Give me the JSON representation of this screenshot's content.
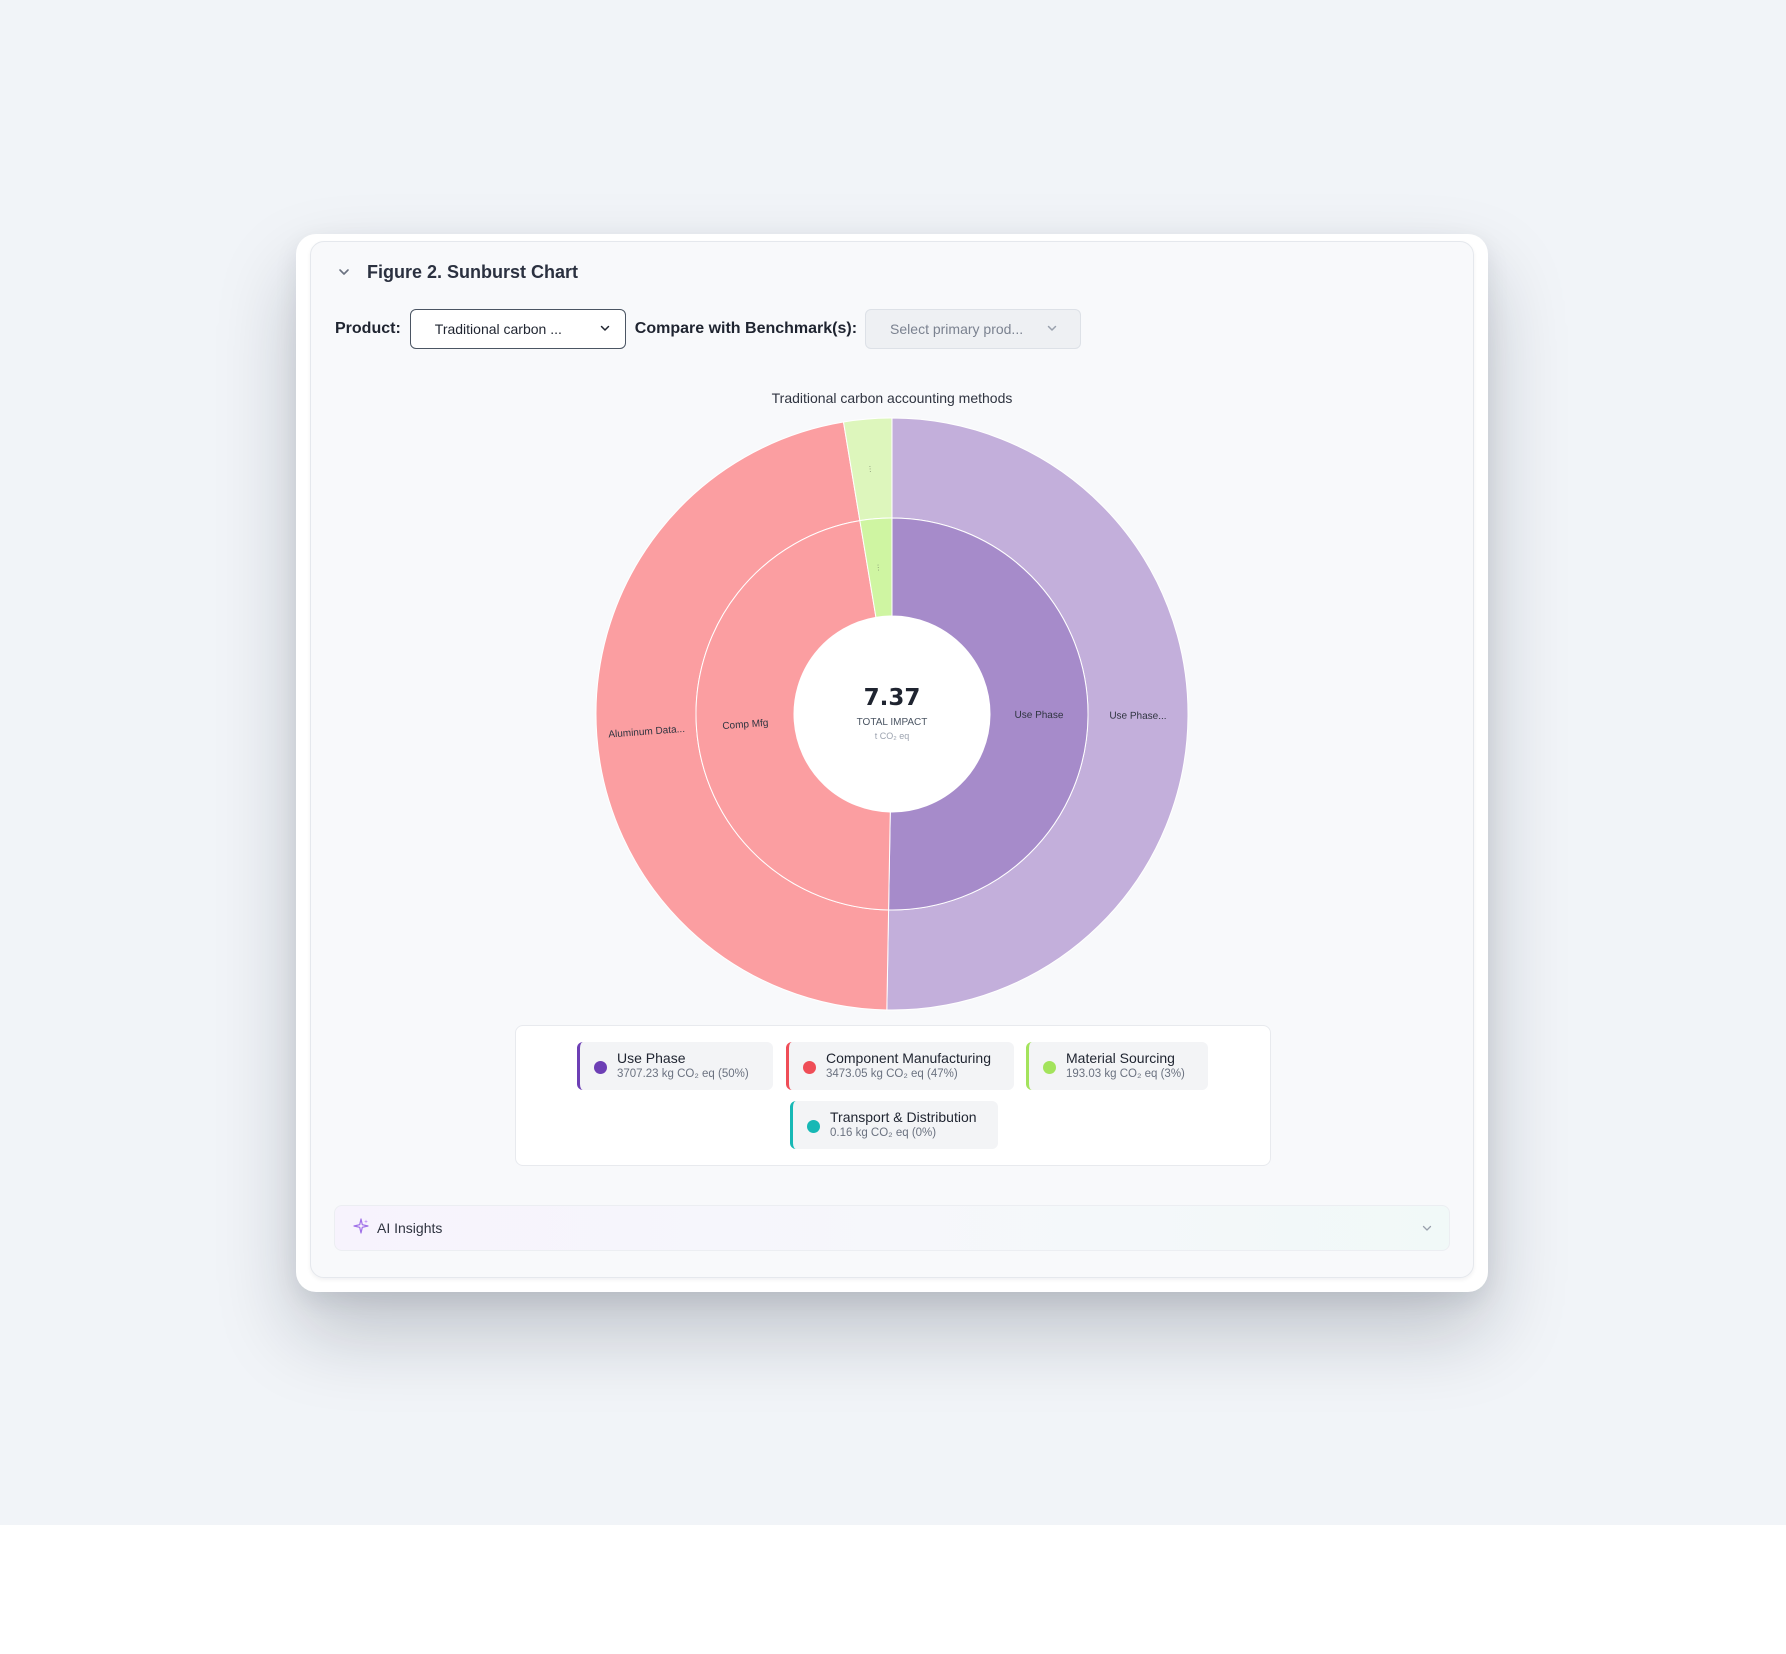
{
  "figure": {
    "title": "Figure 2. Sunburst Chart"
  },
  "controls": {
    "product_label": "Product:",
    "product_value": "Traditional carbon ...",
    "benchmark_label": "Compare with Benchmark(s):",
    "benchmark_placeholder": "Select primary prod..."
  },
  "center": {
    "value": "7.37",
    "label": "TOTAL IMPACT",
    "unit": "t CO₂ eq"
  },
  "legend": [
    {
      "name": "Use Phase",
      "value": "3707.23 kg CO₂ eq (50%)",
      "color": "#6d3fb5"
    },
    {
      "name": "Component Manufacturing",
      "value": "3473.05 kg CO₂ eq (47%)",
      "color": "#ef4d57"
    },
    {
      "name": "Material Sourcing",
      "value": "193.03 kg CO₂ eq (3%)",
      "color": "#a3e35c"
    },
    {
      "name": "Transport & Distribution",
      "value": "0.16 kg CO₂ eq (0%)",
      "color": "#17b8b5"
    }
  ],
  "ai": {
    "label": "AI Insights",
    "icon": "sparkle-icon"
  },
  "chart_data": {
    "type": "sunburst",
    "title": "Traditional carbon accounting methods",
    "unit": "kg CO₂ eq",
    "total_display": "7.37",
    "inner_ring": [
      {
        "label": "Use Phase",
        "category": "Use Phase",
        "value": 3707.23,
        "color": "#a68bca"
      },
      {
        "label": "Comp Mfg",
        "category": "Component Manufacturing",
        "value": 3473.05,
        "color": "#fb9ea1"
      },
      {
        "label": "…",
        "category": "Material Sourcing",
        "value": 193.03,
        "color": "#cff5a2"
      },
      {
        "label": "",
        "category": "Transport & Distribution",
        "value": 0.16,
        "color": "#8fdcda"
      }
    ],
    "outer_ring": [
      {
        "label": "Use Phase...",
        "category": "Use Phase",
        "value": 3707.23,
        "color": "#c3afdb"
      },
      {
        "label": "Aluminum Data...",
        "category": "Component Manufacturing",
        "value": 3473.05,
        "color": "#fb9ea1"
      },
      {
        "label": "…",
        "category": "Material Sourcing",
        "value": 193.03,
        "color": "#ddf6bc"
      },
      {
        "label": "",
        "category": "Transport & Distribution",
        "value": 0.16,
        "color": "#bdeceb"
      }
    ]
  }
}
